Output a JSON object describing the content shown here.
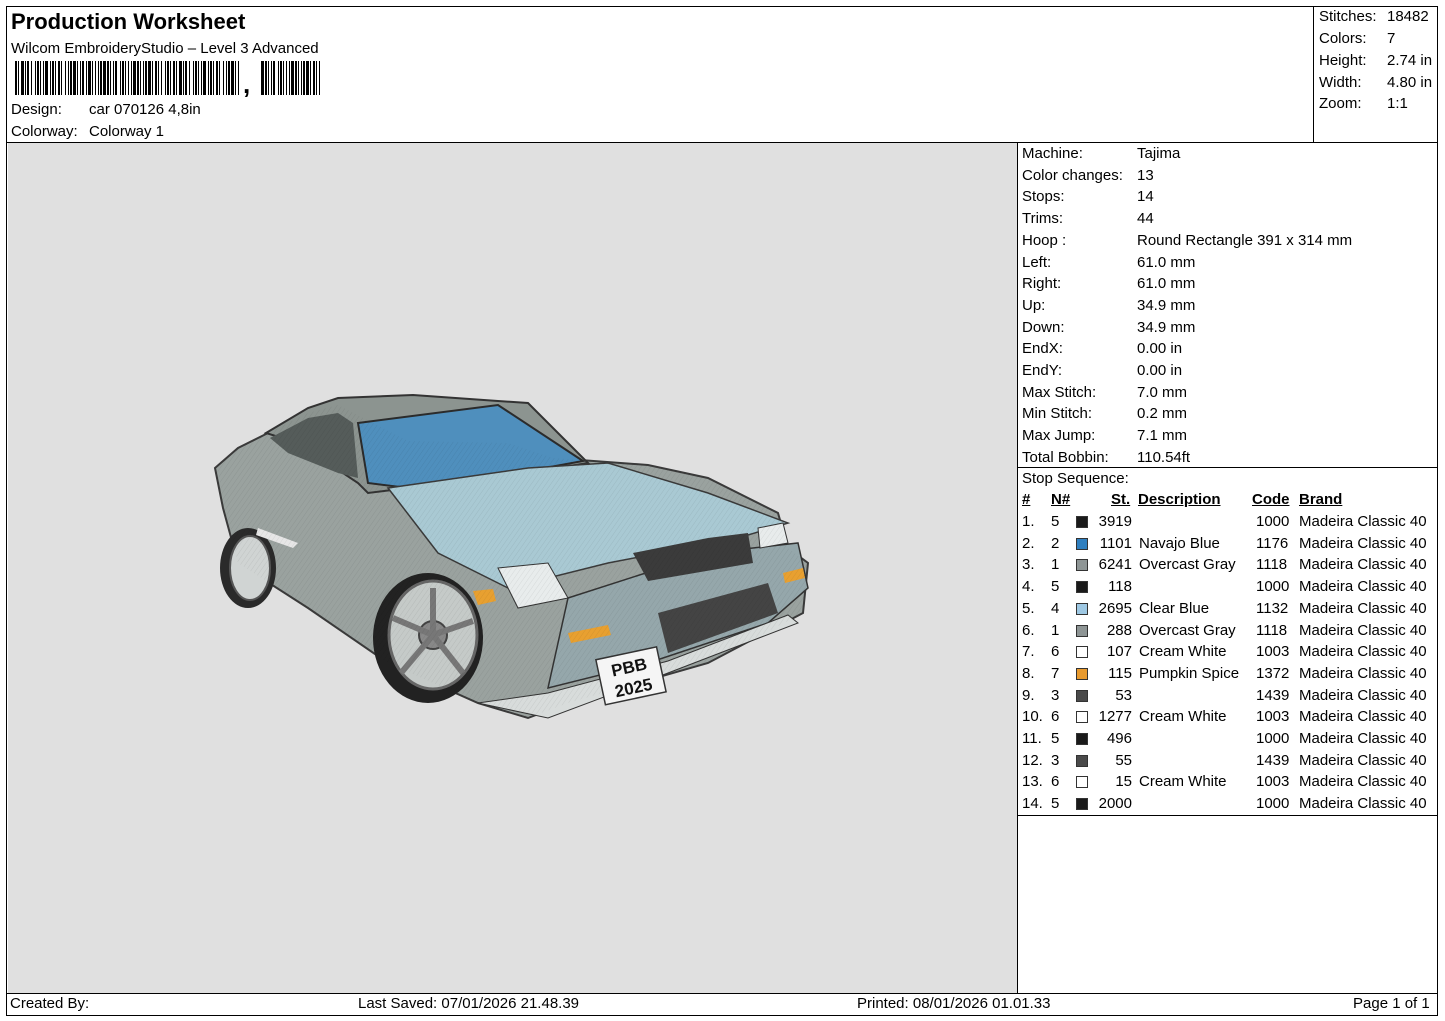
{
  "header": {
    "title": "Production Worksheet",
    "subtitle": "Wilcom EmbroideryStudio – Level 3 Advanced",
    "barcode_comma": ",",
    "design_label": "Design:",
    "design_value": "car 070126 4,8in",
    "colorway_label": "Colorway:",
    "colorway_value": "Colorway 1"
  },
  "stats": [
    {
      "label": "Stitches:",
      "value": "18482"
    },
    {
      "label": "Colors:",
      "value": "7"
    },
    {
      "label": "Height:",
      "value": "2.74 in"
    },
    {
      "label": "Width:",
      "value": "4.80 in"
    },
    {
      "label": "Zoom:",
      "value": "1:1"
    }
  ],
  "machine_info": [
    {
      "label": "Machine:",
      "value": "Tajima"
    },
    {
      "label": "Color changes:",
      "value": "13"
    },
    {
      "label": "Stops:",
      "value": "14"
    },
    {
      "label": "Trims:",
      "value": "44"
    },
    {
      "label": "Hoop :",
      "value": "Round Rectangle 391 x 314 mm"
    },
    {
      "label": "Left:",
      "value": "61.0 mm"
    },
    {
      "label": "Right:",
      "value": "61.0 mm"
    },
    {
      "label": "Up:",
      "value": "34.9 mm"
    },
    {
      "label": "Down:",
      "value": "34.9 mm"
    },
    {
      "label": "EndX:",
      "value": "0.00 in"
    },
    {
      "label": "EndY:",
      "value": "0.00 in"
    },
    {
      "label": "Max Stitch:",
      "value": "7.0 mm"
    },
    {
      "label": "Min Stitch:",
      "value": "0.2 mm"
    },
    {
      "label": "Max Jump:",
      "value": "7.1 mm"
    },
    {
      "label": "Total Bobbin:",
      "value": "110.54ft"
    }
  ],
  "stop_sequence": {
    "title": "Stop Sequence:",
    "columns": {
      "num": "#",
      "n": "N#",
      "st": "St.",
      "desc": "Description",
      "code": "Code",
      "brand": "Brand"
    },
    "rows": [
      {
        "num": "1.",
        "n": "5",
        "color": "#1a1a1a",
        "st": "3919",
        "desc": "",
        "code": "1000",
        "brand": "Madeira Classic 40"
      },
      {
        "num": "2.",
        "n": "2",
        "color": "#2f7fbf",
        "st": "1101",
        "desc": "Navajo Blue",
        "code": "1176",
        "brand": "Madeira Classic 40"
      },
      {
        "num": "3.",
        "n": "1",
        "color": "#8e9595",
        "st": "6241",
        "desc": "Overcast Gray",
        "code": "1118",
        "brand": "Madeira Classic 40"
      },
      {
        "num": "4.",
        "n": "5",
        "color": "#1a1a1a",
        "st": "118",
        "desc": "",
        "code": "1000",
        "brand": "Madeira Classic 40"
      },
      {
        "num": "5.",
        "n": "4",
        "color": "#9ec8e3",
        "st": "2695",
        "desc": "Clear Blue",
        "code": "1132",
        "brand": "Madeira Classic 40"
      },
      {
        "num": "6.",
        "n": "1",
        "color": "#8e9595",
        "st": "288",
        "desc": "Overcast Gray",
        "code": "1118",
        "brand": "Madeira Classic 40"
      },
      {
        "num": "7.",
        "n": "6",
        "color": "#ffffff",
        "st": "107",
        "desc": "Cream White",
        "code": "1003",
        "brand": "Madeira Classic 40"
      },
      {
        "num": "8.",
        "n": "7",
        "color": "#e89a2e",
        "st": "115",
        "desc": "Pumpkin Spice",
        "code": "1372",
        "brand": "Madeira Classic 40"
      },
      {
        "num": "9.",
        "n": "3",
        "color": "#4a4a4a",
        "st": "53",
        "desc": "",
        "code": "1439",
        "brand": "Madeira Classic 40"
      },
      {
        "num": "10.",
        "n": "6",
        "color": "#ffffff",
        "st": "1277",
        "desc": "Cream White",
        "code": "1003",
        "brand": "Madeira Classic 40"
      },
      {
        "num": "11.",
        "n": "5",
        "color": "#1a1a1a",
        "st": "496",
        "desc": "",
        "code": "1000",
        "brand": "Madeira Classic 40"
      },
      {
        "num": "12.",
        "n": "3",
        "color": "#4a4a4a",
        "st": "55",
        "desc": "",
        "code": "1439",
        "brand": "Madeira Classic 40"
      },
      {
        "num": "13.",
        "n": "6",
        "color": "#ffffff",
        "st": "15",
        "desc": "Cream White",
        "code": "1003",
        "brand": "Madeira Classic 40"
      },
      {
        "num": "14.",
        "n": "5",
        "color": "#1a1a1a",
        "st": "2000",
        "desc": "",
        "code": "1000",
        "brand": "Madeira Classic 40"
      }
    ]
  },
  "preview": {
    "plate_line1": "PBB",
    "plate_line2": "2025",
    "background": "#e0e0e0"
  },
  "footer": {
    "created_by": "Created By:",
    "last_saved": "Last Saved: 07/01/2026 21.48.39",
    "printed": "Printed: 08/01/2026 01.01.33",
    "page": "Page 1 of 1"
  }
}
